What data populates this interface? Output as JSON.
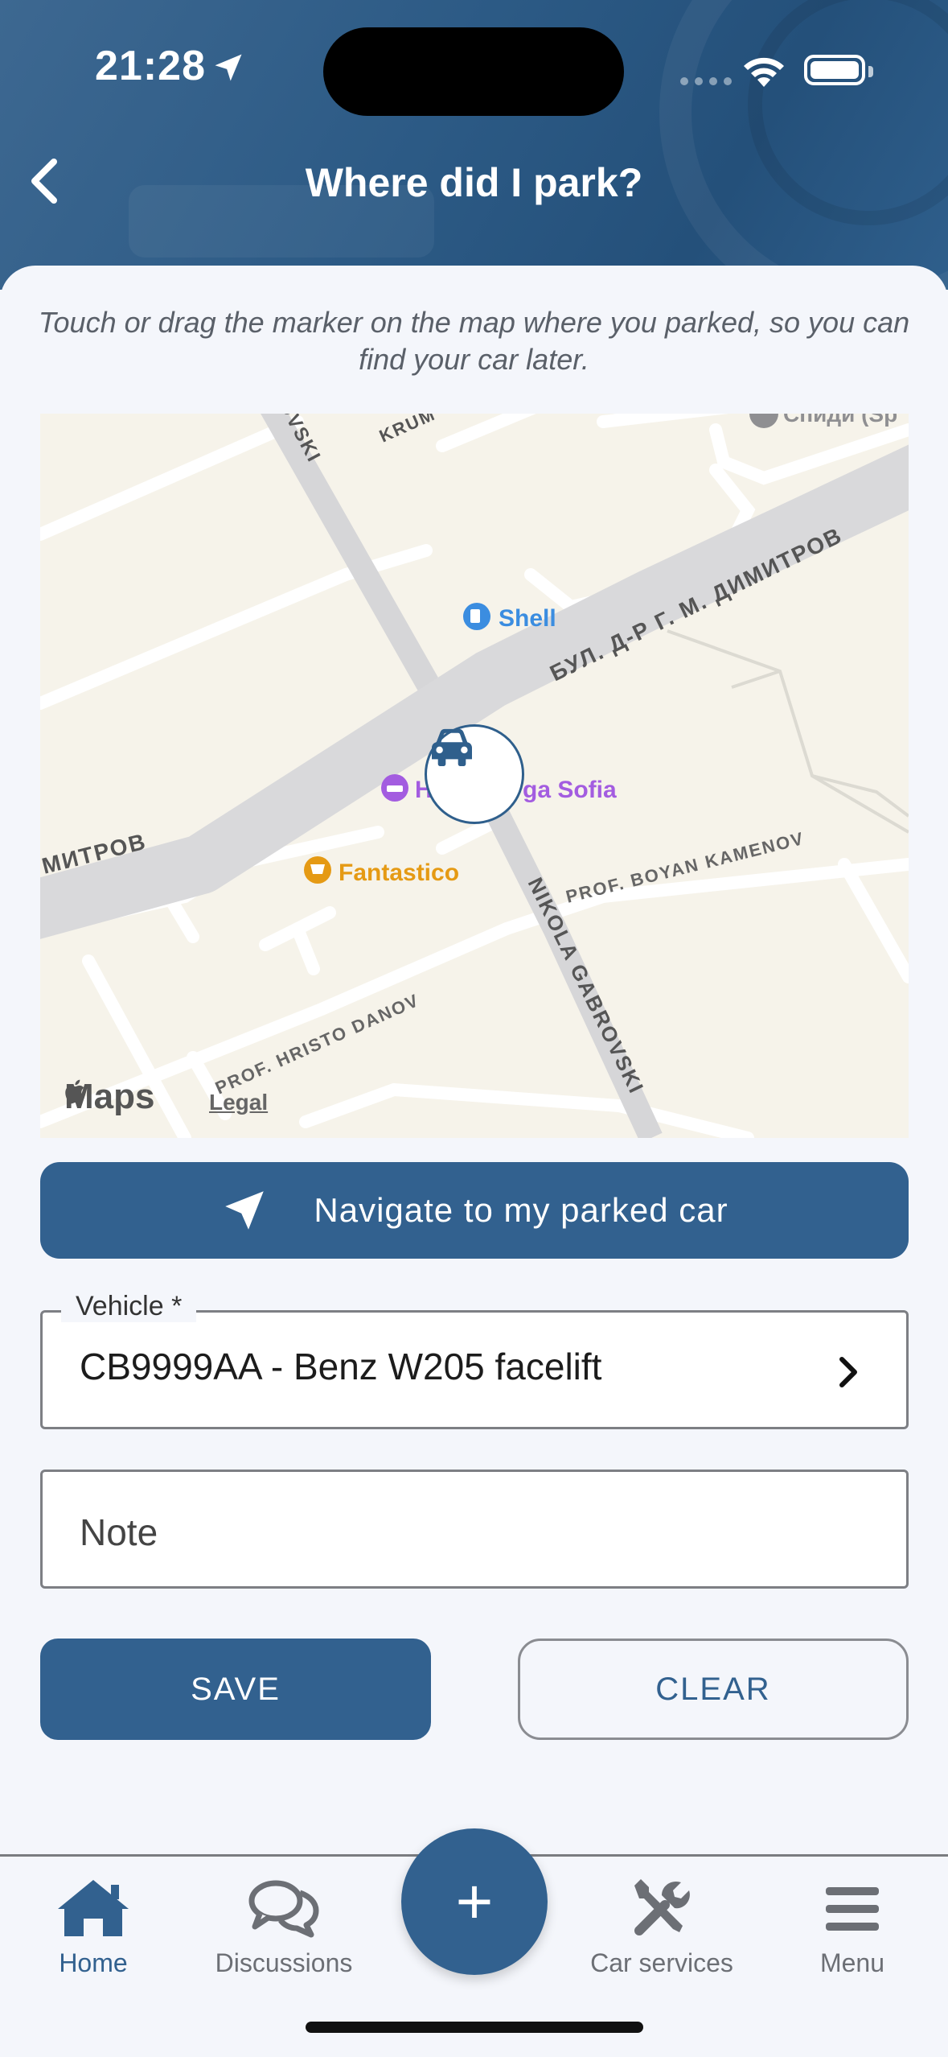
{
  "status_bar": {
    "time": "21:28"
  },
  "header": {
    "title": "Where did I park?"
  },
  "hint": "Touch or drag the marker on the map where you parked, so you can find your car later.",
  "map": {
    "labels": {
      "shell": "Shell",
      "hotel": "Hotel Rega Sofia",
      "hotel_visible": "ga Sofia",
      "hotel_prefix": "H",
      "fantastico": "Fantastico",
      "boulevard": "БУЛ. Д-Р Г. М. ДИМИТРОВ",
      "boulevard_left": "МИТРОВ",
      "street_top": "OVSKI",
      "street_krum": "KRUM",
      "street_gabrovski": "NIKOLA GABROVSKI",
      "street_kamenov": "PROF. BOYAN KAMENOV",
      "street_danov": "PROF. HRISTO DANOV",
      "poi_top_right": "Спиди (Sp",
      "maps_brand": "Maps",
      "legal": "Legal"
    }
  },
  "navigate_button": {
    "label": "Navigate to my parked car"
  },
  "vehicle_field": {
    "label": "Vehicle *",
    "value": "CB9999AA - Benz W205 facelift"
  },
  "note_field": {
    "placeholder": "Note"
  },
  "buttons": {
    "save": "SAVE",
    "clear": "CLEAR"
  },
  "tabbar": {
    "home": "Home",
    "discussions": "Discussions",
    "add": "+",
    "car_services": "Car services",
    "menu": "Menu"
  },
  "colors": {
    "primary": "#32618f",
    "header": "#2c5a85",
    "map_bg": "#f6f3ea",
    "shell": "#3b8de0",
    "hotel": "#a35ce0",
    "fantastico": "#e59a14"
  }
}
